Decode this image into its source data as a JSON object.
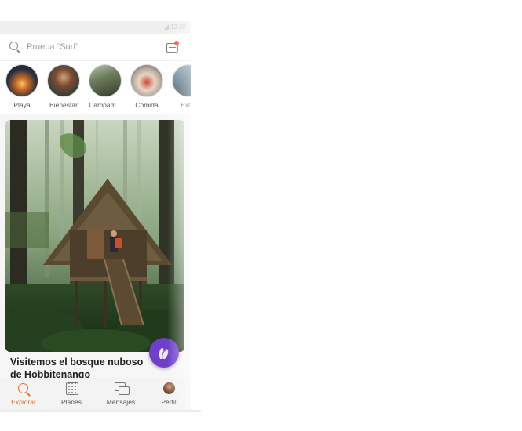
{
  "status_bar": {
    "time": "12:30"
  },
  "search": {
    "placeholder": "Prueba “Surf”"
  },
  "categories": [
    {
      "label": "Playa"
    },
    {
      "label": "Bienestar"
    },
    {
      "label": "Campam..."
    },
    {
      "label": "Comida"
    },
    {
      "label": "Extre"
    }
  ],
  "card": {
    "title": "Visitemos el bosque nuboso de Hobbitenango"
  },
  "tabs": [
    {
      "label": "Explorar"
    },
    {
      "label": "Planes"
    },
    {
      "label": "Mensajes"
    },
    {
      "label": "Perfil"
    }
  ],
  "colors": {
    "accent": "#f06a2b",
    "fab": "#6d3fcb",
    "notification": "#f0462e"
  }
}
